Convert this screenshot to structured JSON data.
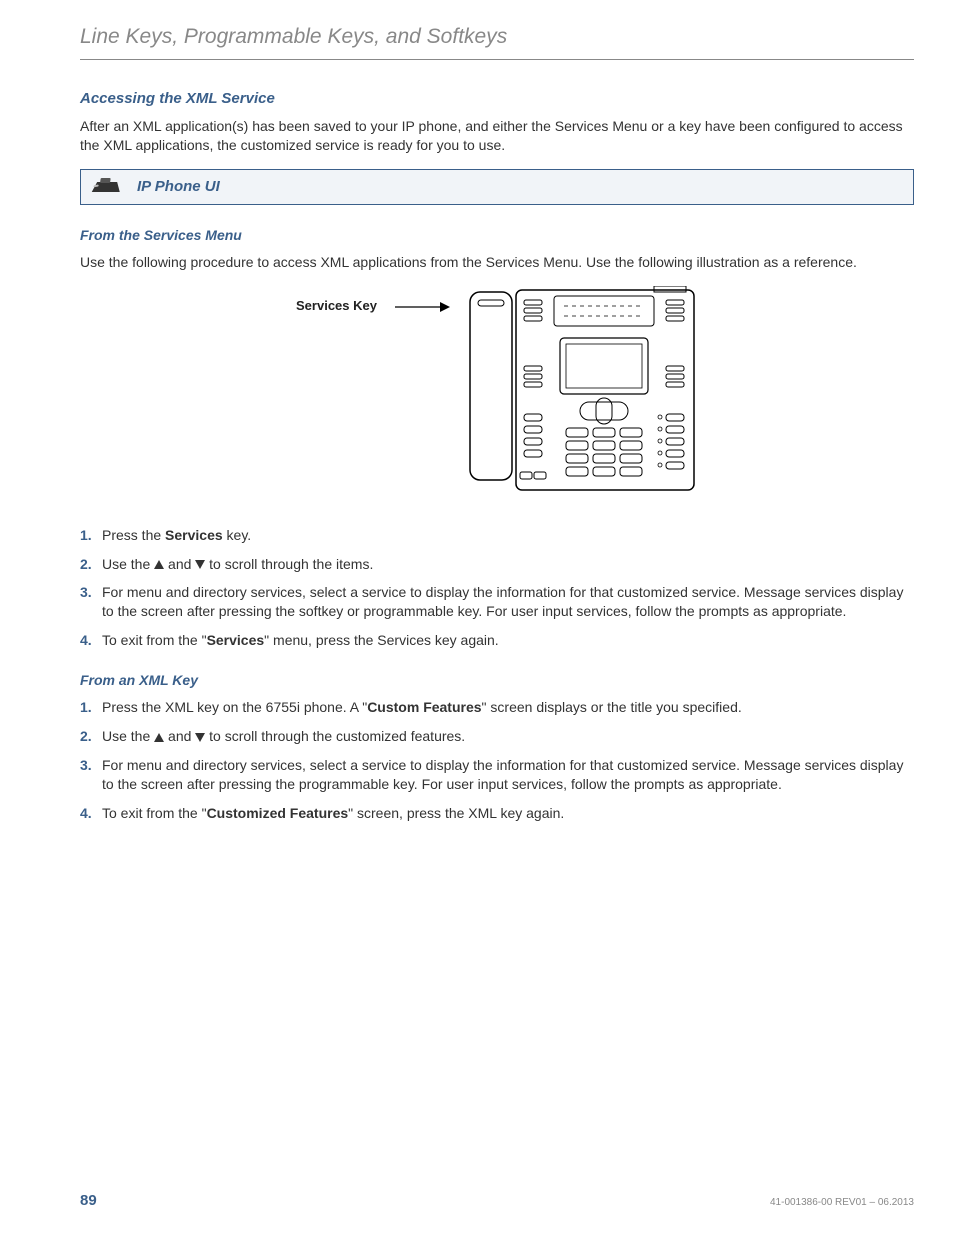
{
  "header": "Line Keys, Programmable Keys, and Softkeys",
  "section": {
    "title": "Accessing the XML Service",
    "intro": "After an XML application(s) has been saved to your IP phone, and either the Services Menu or a key have been configured to access the XML applications, the customized service is ready for you to use."
  },
  "callout": {
    "label": "IP Phone UI"
  },
  "services_menu": {
    "title": "From the Services Menu",
    "intro": "Use the following procedure to access XML applications from the Services Menu. Use the following illustration as a reference.",
    "figure_label": "Services Key",
    "steps": {
      "s1a": "Press the ",
      "s1b": "Services",
      "s1c": " key.",
      "s2a": "Use the ",
      "s2b": " and ",
      "s2c": " to scroll through the items.",
      "s3": "For menu and directory services, select a service to display the information for that customized service. Message services display to the screen after pressing the softkey or programmable key. For user input services, follow the prompts as appropriate.",
      "s4a": "To exit from the \"",
      "s4b": "Services",
      "s4c": "\" menu, press the Services key again."
    }
  },
  "xml_key": {
    "title": "From an XML Key",
    "steps": {
      "s1a": "Press the XML key on the 6755i phone. A \"",
      "s1b": "Custom Features",
      "s1c": "\" screen displays or the title you specified.",
      "s2a": "Use the ",
      "s2b": " and ",
      "s2c": " to scroll through the customized features.",
      "s3": "For menu and directory services, select a service to display the information for that customized service. Message services display to the screen after pressing the programmable key. For user input services, follow the prompts as appropriate.",
      "s4a": "To exit from the \"",
      "s4b": "Customized Features",
      "s4c": "\" screen, press the XML key again."
    }
  },
  "footer": {
    "page": "89",
    "rev": "41-001386-00 REV01 – 06.2013"
  }
}
